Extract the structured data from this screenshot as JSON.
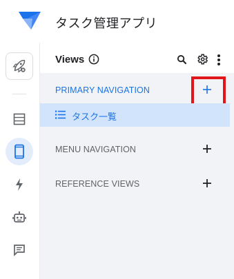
{
  "app": {
    "title": "タスク管理アプリ",
    "logo_icon": "appsheet-logo-icon",
    "accent_color": "#1a73e8"
  },
  "rail": {
    "items": [
      {
        "name": "deploy",
        "icon": "rocket-icon"
      },
      {
        "name": "data",
        "icon": "table-icon"
      },
      {
        "name": "views",
        "icon": "mobile-phone-icon",
        "selected": true
      },
      {
        "name": "actions",
        "icon": "bolt-icon"
      },
      {
        "name": "automation",
        "icon": "robot-icon"
      },
      {
        "name": "chat",
        "icon": "chat-icon"
      }
    ]
  },
  "panel": {
    "title": "Views",
    "header_icons": [
      "info-icon",
      "search-icon",
      "gear-icon",
      "more-vert-icon"
    ],
    "sections": [
      {
        "label": "PRIMARY NAVIGATION",
        "add": "+"
      },
      {
        "label": "MENU NAVIGATION",
        "add": "+"
      },
      {
        "label": "REFERENCE VIEWS",
        "add": "+"
      }
    ],
    "primary_items": [
      {
        "label": "タスク一覧",
        "icon": "list-icon",
        "selected": true
      }
    ],
    "highlight_color": "#e0161b"
  }
}
